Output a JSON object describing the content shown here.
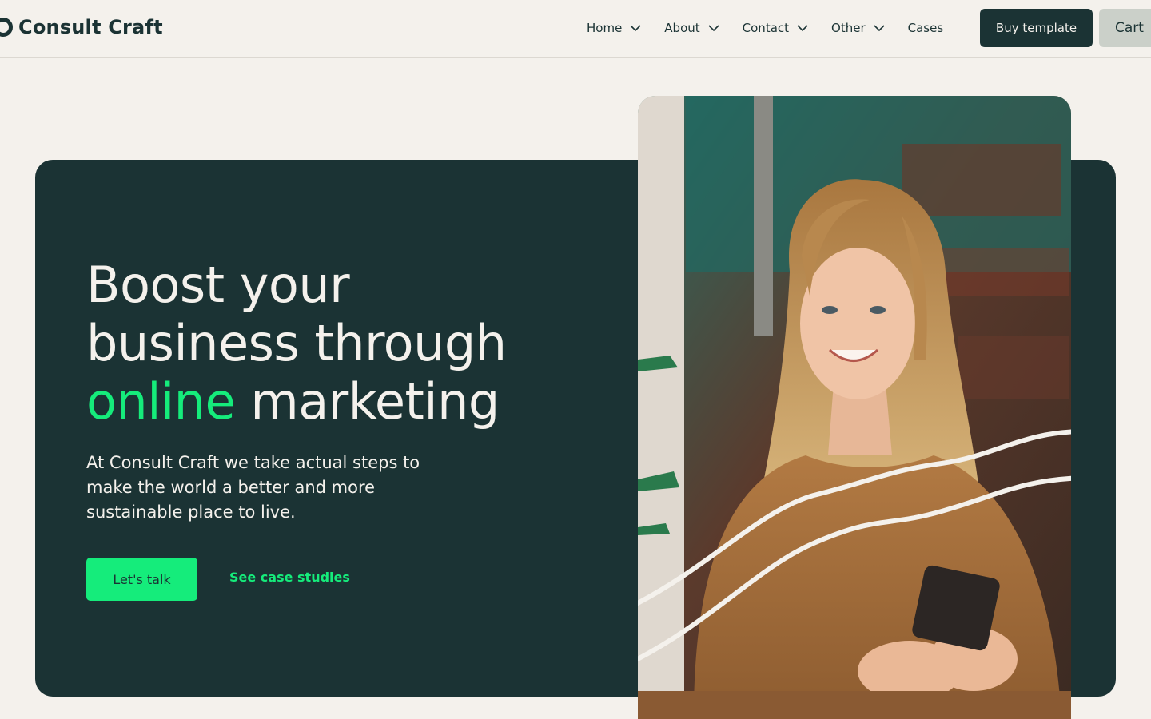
{
  "brand": {
    "name": "Consult Craft",
    "logo_icon": "ring-logo-icon"
  },
  "nav": {
    "items": [
      {
        "label": "Home",
        "has_dropdown": true
      },
      {
        "label": "About",
        "has_dropdown": true
      },
      {
        "label": "Contact",
        "has_dropdown": true
      },
      {
        "label": "Other",
        "has_dropdown": true
      },
      {
        "label": "Cases",
        "has_dropdown": false
      }
    ],
    "buy_label": "Buy template",
    "cart_label": "Cart"
  },
  "hero": {
    "title_line1": "Boost your",
    "title_line2": "business through",
    "title_accent": "online",
    "title_end": "marketing",
    "description": "At Consult Craft we take actual steps to make the world a better and more sustainable place to live.",
    "primary_cta": "Let's talk",
    "secondary_cta": "See case studies"
  },
  "colors": {
    "background": "#f4f1ec",
    "dark_green": "#1b3334",
    "accent_green": "#15ec7b",
    "cart_bg": "#cbd0c9"
  }
}
